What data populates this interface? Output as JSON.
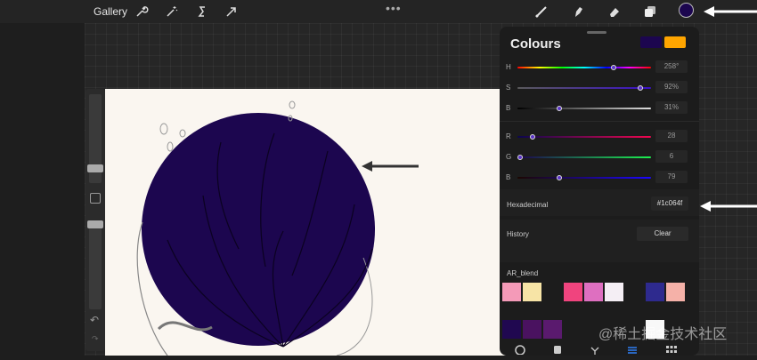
{
  "toolbar": {
    "gallery_label": "Gallery",
    "more_label": "•••",
    "left_tools": [
      "wrench-icon",
      "magic-wand-icon",
      "selection-s-icon",
      "transform-arrow-icon"
    ],
    "right_tools": [
      "brush-icon",
      "smudge-icon",
      "eraser-icon",
      "layers-icon"
    ],
    "active_color": "#1c064f"
  },
  "colours_panel": {
    "title": "Colours",
    "primary_color": "#1c064f",
    "secondary_color": "#ffa500",
    "hsb": [
      {
        "label": "H",
        "value": "258°",
        "fraction": 0.72
      },
      {
        "label": "S",
        "value": "92%",
        "fraction": 0.92
      },
      {
        "label": "B",
        "value": "31%",
        "fraction": 0.31
      }
    ],
    "rgb": [
      {
        "label": "R",
        "value": "28",
        "fraction": 0.11
      },
      {
        "label": "G",
        "value": "6",
        "fraction": 0.02
      },
      {
        "label": "B",
        "value": "79",
        "fraction": 0.31
      }
    ],
    "hex_label": "Hexadecimal",
    "hex_value": "#1c064f",
    "history_label": "History",
    "clear_label": "Clear",
    "palette_name": "AR_blend",
    "palette_row1": [
      "#f49ab8",
      "#f7e4a6",
      "",
      "#f0447e",
      "#de6fc0",
      "#f4eef4",
      "",
      "#2e2a8e",
      "#f5b1a8"
    ],
    "palette_row2": [
      "#200850",
      "#4a1260",
      "#5a1a6e",
      "",
      "",
      "",
      "",
      "#f8f8f8",
      ""
    ]
  },
  "watermark": "@稀土掘金技术社区"
}
